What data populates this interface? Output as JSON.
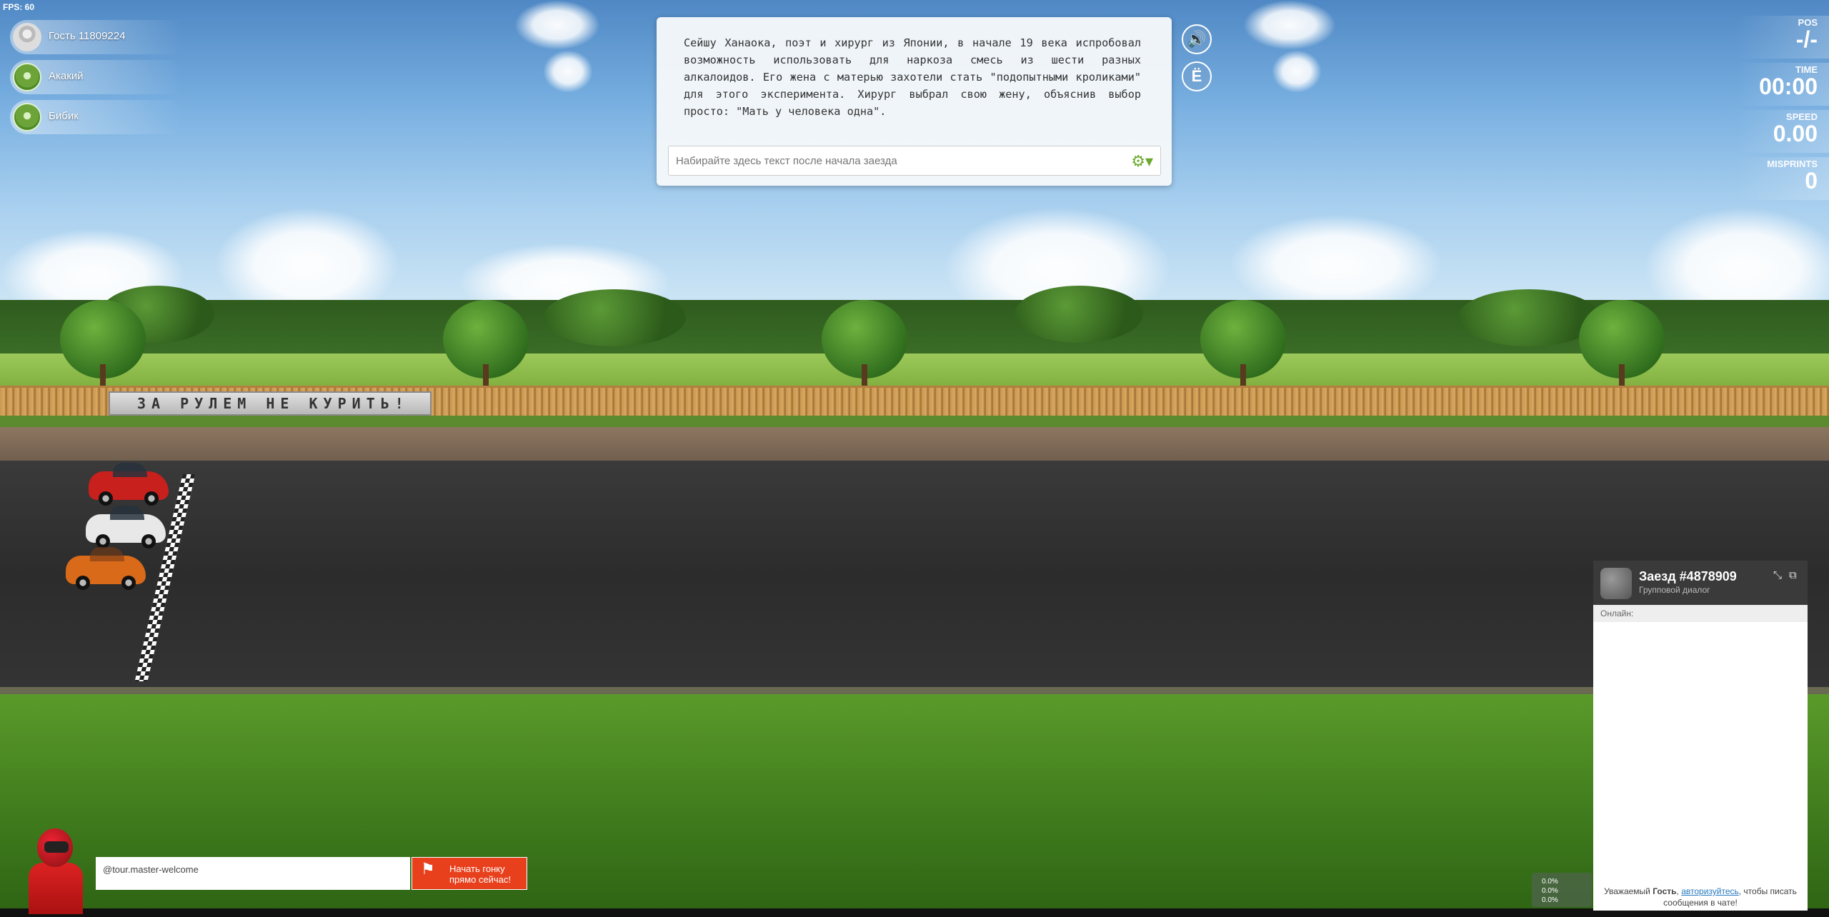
{
  "hud": {
    "fps": "FPS: 60",
    "pos_label": "POS",
    "pos_value": "-/-",
    "time_label": "TIME",
    "time_value": "00:00",
    "speed_label": "SPEED",
    "speed_value": "0.00",
    "misprints_label": "MISPRINTS",
    "misprints_value": "0"
  },
  "players": [
    {
      "name": "Гость 11809224",
      "avatar_icon": "user-avatar-icon"
    },
    {
      "name": "Акакий",
      "avatar_icon": "robot-avatar-icon"
    },
    {
      "name": "Бибик",
      "avatar_icon": "robot-avatar-icon"
    }
  ],
  "text_panel": {
    "text": "Сейшу Ханаока, поэт и хирург из Японии, в начале 19 века испробовал возможность использовать для наркоза смесь из шести разных алкалоидов. Его жена с матерью захотели стать \"подопытными кроликами\" для этого эксперимента. Хирург выбрал свою жену, объяснив выбор просто: \"Мать у человека одна\".",
    "input_placeholder": "Набирайте здесь текст после начала заезда",
    "settings_icon": "gears-icon"
  },
  "side_buttons": {
    "sound_icon": "speaker-icon",
    "yo_label": "Ё"
  },
  "scene": {
    "banner_text": "ЗА РУЛЕМ НЕ КУРИТЬ!"
  },
  "cars": [
    {
      "color": "#c8201c"
    },
    {
      "color": "#e8e8e8"
    },
    {
      "color": "#d86a1a"
    }
  ],
  "chat": {
    "title": "Заезд #4878909",
    "subtitle": "Групповой диалог",
    "online_label": "Онлайн:",
    "footer_prefix": "Уважаемый ",
    "footer_guest": "Гость",
    "footer_sep": ", ",
    "footer_link": "авторизуйтесь",
    "footer_suffix": ", чтобы писать сообщения в чате!"
  },
  "mini_stats": [
    "0.0%",
    "0.0%",
    "0.0%"
  ],
  "promo": {
    "channel": "@tour.master-welcome",
    "button_line1": "Начать гонку",
    "button_line2": "прямо сейчас!"
  }
}
